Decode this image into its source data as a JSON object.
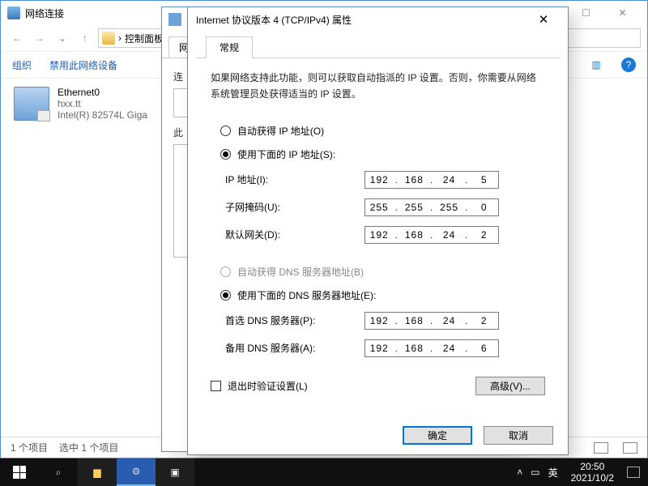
{
  "explorer": {
    "title": "网络连接",
    "breadcrumb": "控制面板",
    "cmds": {
      "org": "组织",
      "disable": "禁用此网络设备"
    },
    "adapter": {
      "name": "Ethernet0",
      "domain": "hxx.tt",
      "driver": "Intel(R) 82574L Giga"
    },
    "status": {
      "count": "1 个项目",
      "selected": "选中 1 个项目"
    }
  },
  "dlg1": {
    "tab": "网络",
    "conn_label": "连",
    "this_label": "此"
  },
  "dlg2": {
    "title": "Internet 协议版本 4 (TCP/IPv4) 属性",
    "tab": "常规",
    "desc": "如果网络支持此功能，则可以获取自动指派的 IP 设置。否则，你需要从网络系统管理员处获得适当的 IP 设置。",
    "radio_auto_ip": "自动获得 IP 地址(O)",
    "radio_manual_ip": "使用下面的 IP 地址(S):",
    "ip_label": "IP 地址(I):",
    "mask_label": "子网掩码(U):",
    "gw_label": "默认网关(D):",
    "ip": [
      "192",
      "168",
      "24",
      "5"
    ],
    "mask": [
      "255",
      "255",
      "255",
      "0"
    ],
    "gw": [
      "192",
      "168",
      "24",
      "2"
    ],
    "radio_auto_dns": "自动获得 DNS 服务器地址(B)",
    "radio_manual_dns": "使用下面的 DNS 服务器地址(E):",
    "dns1_label": "首选 DNS 服务器(P):",
    "dns2_label": "备用 DNS 服务器(A):",
    "dns1": [
      "192",
      "168",
      "24",
      "2"
    ],
    "dns2": [
      "192",
      "168",
      "24",
      "6"
    ],
    "validate": "退出时验证设置(L)",
    "advanced": "高级(V)...",
    "ok": "确定",
    "cancel": "取消"
  },
  "taskbar": {
    "ime": "英",
    "time": "20:50",
    "date": "2021/10/2"
  }
}
